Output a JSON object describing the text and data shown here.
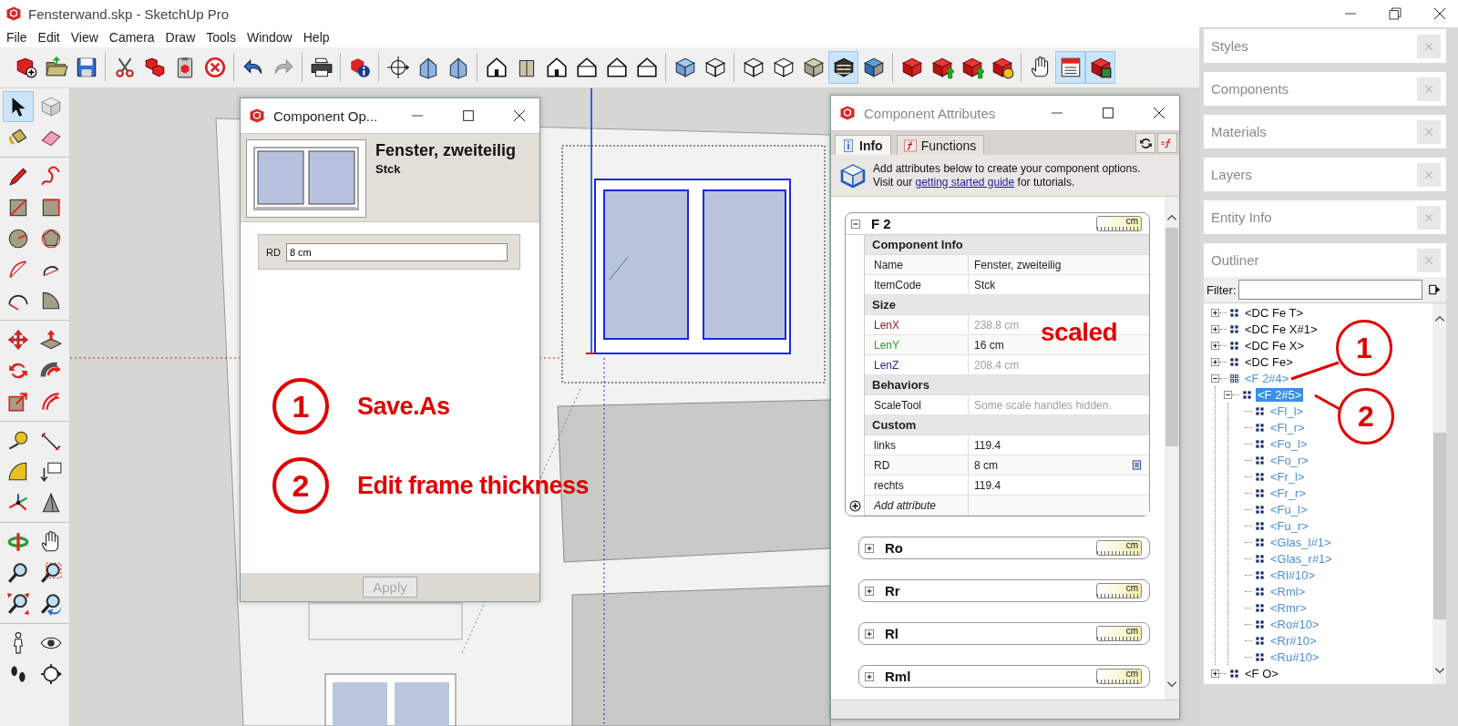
{
  "window": {
    "title": "Fensterwand.skp - SketchUp Pro"
  },
  "menu": [
    "File",
    "Edit",
    "View",
    "Camera",
    "Draw",
    "Tools",
    "Window",
    "Help"
  ],
  "toolbar": [
    {
      "items": [
        {
          "kind": "new",
          "selected": false,
          "disabled": false
        },
        {
          "kind": "folder",
          "selected": false,
          "disabled": false
        },
        {
          "kind": "floppy",
          "selected": false,
          "disabled": false
        }
      ]
    },
    {
      "items": [
        {
          "kind": "scissors",
          "selected": false,
          "disabled": false
        },
        {
          "kind": "copy",
          "selected": false,
          "disabled": false
        },
        {
          "kind": "clipboard",
          "selected": false,
          "disabled": false
        },
        {
          "kind": "cancel",
          "selected": false,
          "disabled": false
        }
      ]
    },
    {
      "items": [
        {
          "kind": "undo",
          "selected": false,
          "disabled": false
        },
        {
          "kind": "redo",
          "selected": false,
          "disabled": true
        }
      ]
    },
    {
      "items": [
        {
          "kind": "printer",
          "selected": false,
          "disabled": false
        }
      ]
    },
    {
      "items": [
        {
          "kind": "info",
          "selected": false,
          "disabled": false
        }
      ]
    },
    {
      "items": [
        {
          "kind": "crosshair",
          "selected": false,
          "disabled": false
        },
        {
          "kind": "house-iso",
          "selected": false,
          "disabled": false
        },
        {
          "kind": "house-iso",
          "selected": false,
          "disabled": false
        }
      ]
    },
    {
      "items": [
        {
          "kind": "house",
          "selected": false,
          "disabled": false
        },
        {
          "kind": "box",
          "selected": false,
          "disabled": false
        },
        {
          "kind": "house",
          "selected": false,
          "disabled": false
        },
        {
          "kind": "house-outline",
          "selected": false,
          "disabled": false
        },
        {
          "kind": "house-outline",
          "selected": false,
          "disabled": false
        },
        {
          "kind": "house-outline",
          "selected": false,
          "disabled": false
        }
      ]
    },
    {
      "items": [
        {
          "kind": "cube-xray",
          "selected": false,
          "disabled": false
        },
        {
          "kind": "cube-wire",
          "selected": false,
          "disabled": false
        }
      ]
    },
    {
      "items": [
        {
          "kind": "cube-wire",
          "selected": false,
          "disabled": false
        },
        {
          "kind": "cube-hidden",
          "selected": false,
          "disabled": false
        },
        {
          "kind": "cube-shaded",
          "selected": false,
          "disabled": false
        },
        {
          "kind": "cube-striped",
          "selected": true,
          "disabled": false
        },
        {
          "kind": "cube-mono",
          "selected": false,
          "disabled": false
        }
      ]
    },
    {
      "items": [
        {
          "kind": "cube-red",
          "selected": false,
          "disabled": false
        },
        {
          "kind": "cube-upload",
          "selected": false,
          "disabled": false
        },
        {
          "kind": "cube-upload",
          "selected": false,
          "disabled": false
        },
        {
          "kind": "cube-sync",
          "selected": false,
          "disabled": false
        }
      ]
    },
    {
      "items": [
        {
          "kind": "hand",
          "selected": false,
          "disabled": false
        },
        {
          "kind": "form",
          "selected": true,
          "disabled": false
        },
        {
          "kind": "cube-form",
          "selected": true,
          "disabled": false
        }
      ]
    }
  ],
  "tool_palette": [
    {
      "items": [
        {
          "kind": "pointer",
          "selected": true
        },
        {
          "kind": "cube-gray",
          "selected": false
        },
        {
          "kind": "bucket",
          "selected": false
        },
        {
          "kind": "eraser",
          "selected": false
        }
      ]
    },
    {
      "items": [
        {
          "kind": "pencil",
          "selected": false
        },
        {
          "kind": "freehand",
          "selected": false
        },
        {
          "kind": "rect",
          "selected": false
        },
        {
          "kind": "rect-rot",
          "selected": false
        },
        {
          "kind": "circle",
          "selected": false
        },
        {
          "kind": "polygon",
          "selected": false
        },
        {
          "kind": "arc",
          "selected": false
        },
        {
          "kind": "arc2",
          "selected": false
        },
        {
          "kind": "arc3",
          "selected": false
        },
        {
          "kind": "pie",
          "selected": false
        }
      ]
    },
    {
      "items": [
        {
          "kind": "move",
          "selected": false
        },
        {
          "kind": "pushpull",
          "selected": false
        },
        {
          "kind": "rotate",
          "selected": false
        },
        {
          "kind": "followme",
          "selected": false
        },
        {
          "kind": "scale",
          "selected": false
        },
        {
          "kind": "offset",
          "selected": false
        }
      ]
    },
    {
      "items": [
        {
          "kind": "tape",
          "selected": false
        },
        {
          "kind": "dimension",
          "selected": false
        },
        {
          "kind": "protractor",
          "selected": false
        },
        {
          "kind": "textlabel",
          "selected": false
        },
        {
          "kind": "axes",
          "selected": false
        },
        {
          "kind": "pyramid",
          "selected": false
        }
      ]
    },
    {
      "items": [
        {
          "kind": "orbit",
          "selected": false
        },
        {
          "kind": "hand",
          "selected": false
        },
        {
          "kind": "zoom",
          "selected": false
        },
        {
          "kind": "zoomwin",
          "selected": false
        },
        {
          "kind": "zoomext",
          "selected": false
        },
        {
          "kind": "zoomprev",
          "selected": false
        }
      ]
    },
    {
      "items": [
        {
          "kind": "person",
          "selected": false
        },
        {
          "kind": "eye",
          "selected": false
        },
        {
          "kind": "walk",
          "selected": false
        },
        {
          "kind": "section",
          "selected": false
        }
      ]
    }
  ],
  "component_options": {
    "title": "Component Op...",
    "name": "Fenster, zweiteilig",
    "subtitle": "Stck",
    "fields": [
      {
        "label": "RD",
        "value": "8 cm"
      }
    ],
    "apply": {
      "label": "Apply",
      "disabled": true
    },
    "annotations": [
      {
        "number": "1",
        "text": "Save.As"
      },
      {
        "number": "2",
        "text": "Edit frame thickness"
      }
    ]
  },
  "component_attributes": {
    "title": "Component Attributes",
    "tabs": [
      {
        "label": "Info",
        "kind": "info",
        "selected": true
      },
      {
        "label": "Functions",
        "kind": "functions",
        "selected": false
      }
    ],
    "intro": "Add attributes below to create your component options.",
    "visit_before": "Visit our ",
    "link": "getting started guide",
    "visit_after": " for tutorials.",
    "panels": [
      {
        "title": "F 2",
        "expanded": true,
        "unit": "cm",
        "add_label": "Add attribute",
        "sections": [
          {
            "title": "Component Info",
            "rows": [
              {
                "label": "Name",
                "value": "Fenster, zweiteilig",
                "dimmed": false,
                "user_option": false
              },
              {
                "label": "ItemCode",
                "value": "Stck",
                "dimmed": false,
                "user_option": false
              }
            ]
          },
          {
            "title": "Size",
            "rows": [
              {
                "label": "LenX",
                "value": "238.8 cm",
                "dimmed": true,
                "user_option": false,
                "color": "#8b1e1e"
              },
              {
                "label": "LenY",
                "value": "16 cm",
                "dimmed": false,
                "user_option": false,
                "color": "#2e9b2e"
              },
              {
                "label": "LenZ",
                "value": "208.4 cm",
                "dimmed": true,
                "user_option": false,
                "color": "#23308a"
              }
            ]
          },
          {
            "title": "Behaviors",
            "rows": [
              {
                "label": "ScaleTool",
                "value": "Some scale handles hidden.",
                "dimmed": true,
                "user_option": false
              }
            ]
          },
          {
            "title": "Custom",
            "rows": [
              {
                "label": "links",
                "value": "119.4",
                "dimmed": false,
                "user_option": false
              },
              {
                "label": "RD",
                "value": "8 cm",
                "dimmed": false,
                "user_option": true
              },
              {
                "label": "rechts",
                "value": "119.4",
                "dimmed": false,
                "user_option": false
              }
            ]
          }
        ]
      },
      {
        "title": "Ro",
        "expanded": false,
        "unit": "cm"
      },
      {
        "title": "Rr",
        "expanded": false,
        "unit": "cm"
      },
      {
        "title": "Rl",
        "expanded": false,
        "unit": "cm"
      },
      {
        "title": "Rml",
        "expanded": false,
        "unit": "cm"
      }
    ],
    "annotation": "scaled"
  },
  "trays": [
    {
      "title": "Styles"
    },
    {
      "title": "Components"
    },
    {
      "title": "Materials"
    },
    {
      "title": "Layers"
    },
    {
      "title": "Entity Info"
    }
  ],
  "outliner": {
    "title": "Outliner",
    "filter_label": "Filter:",
    "tree": [
      {
        "label": "<DC Fe T>",
        "kind": "component",
        "expanded": false,
        "selected": false,
        "highlighted": false
      },
      {
        "label": "<DC Fe X#1>",
        "kind": "component",
        "expanded": false,
        "selected": false,
        "highlighted": false
      },
      {
        "label": "<DC Fe X>",
        "kind": "component",
        "expanded": false,
        "selected": false,
        "highlighted": false
      },
      {
        "label": "<DC Fe>",
        "kind": "component",
        "expanded": false,
        "selected": false,
        "highlighted": false
      },
      {
        "label": "<F 2#4>",
        "kind": "open-component",
        "expanded": true,
        "selected": false,
        "highlighted": true,
        "children": [
          {
            "label": "<F 2#5>",
            "kind": "component",
            "expanded": true,
            "selected": true,
            "highlighted": true,
            "children": [
              {
                "label": "<Fl_l>",
                "kind": "component",
                "selected": false,
                "highlighted": true
              },
              {
                "label": "<Fl_r>",
                "kind": "component",
                "selected": false,
                "highlighted": true
              },
              {
                "label": "<Fo_l>",
                "kind": "component",
                "selected": false,
                "highlighted": true
              },
              {
                "label": "<Fo_r>",
                "kind": "component",
                "selected": false,
                "highlighted": true
              },
              {
                "label": "<Fr_l>",
                "kind": "component",
                "selected": false,
                "highlighted": true
              },
              {
                "label": "<Fr_r>",
                "kind": "component",
                "selected": false,
                "highlighted": true
              },
              {
                "label": "<Fu_l>",
                "kind": "component",
                "selected": false,
                "highlighted": true
              },
              {
                "label": "<Fu_r>",
                "kind": "component",
                "selected": false,
                "highlighted": true
              },
              {
                "label": "<Glas_l#1>",
                "kind": "component",
                "selected": false,
                "highlighted": true
              },
              {
                "label": "<Glas_r#1>",
                "kind": "component",
                "selected": false,
                "highlighted": true
              },
              {
                "label": "<Rl#10>",
                "kind": "component",
                "selected": false,
                "highlighted": true
              },
              {
                "label": "<Rml>",
                "kind": "component",
                "selected": false,
                "highlighted": true
              },
              {
                "label": "<Rmr>",
                "kind": "component",
                "selected": false,
                "highlighted": true
              },
              {
                "label": "<Ro#10>",
                "kind": "component",
                "selected": false,
                "highlighted": true
              },
              {
                "label": "<Rr#10>",
                "kind": "component",
                "selected": false,
                "highlighted": true
              },
              {
                "label": "<Ru#10>",
                "kind": "component",
                "selected": false,
                "highlighted": true
              }
            ]
          }
        ]
      },
      {
        "label": "<F O>",
        "kind": "component",
        "expanded": false,
        "selected": false,
        "highlighted": false
      }
    ],
    "annotations": [
      {
        "number": "1"
      },
      {
        "number": "2"
      }
    ]
  }
}
